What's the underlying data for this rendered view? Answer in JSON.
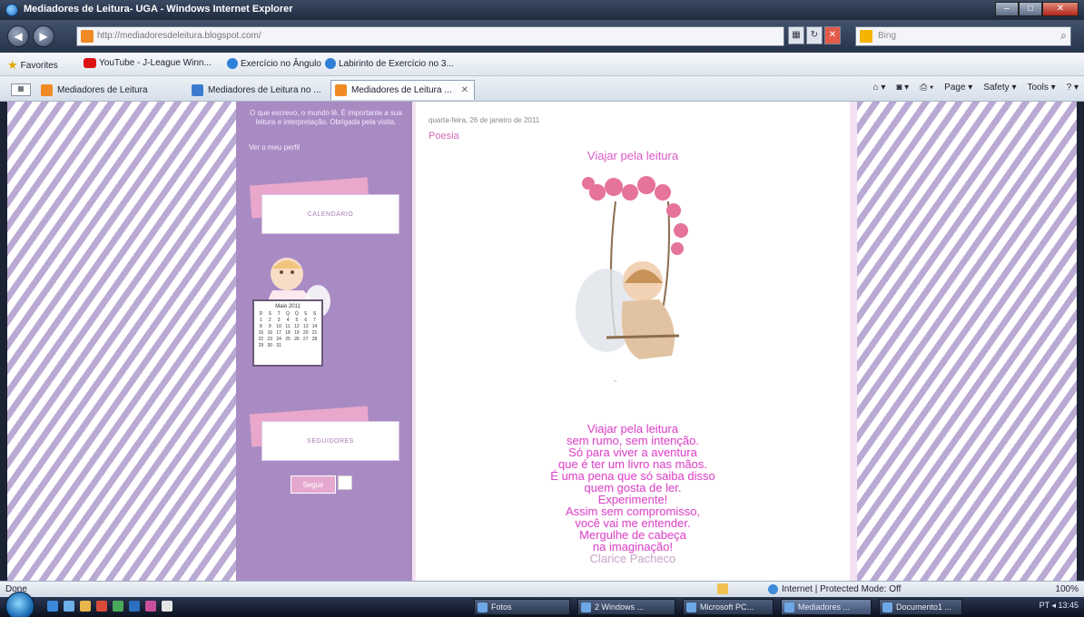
{
  "window": {
    "title": "Mediadores de Leitura- UGA - Windows Internet Explorer",
    "buttons": {
      "minimize": "–",
      "maximize": "□",
      "close": "✕"
    }
  },
  "addressbar": {
    "back_icon": "back-arrow-icon",
    "forward_icon": "forward-arrow-icon",
    "url": "http://mediadoresdeleitura.blogspot.com/",
    "search_placeholder": "Bing"
  },
  "favorites": {
    "label": "Favorites",
    "items": [
      {
        "label": "YouTube - J-League Winn..."
      },
      {
        "label": "Exercício no Ângulo"
      },
      {
        "label": "Labirinto de Exercício no 3..."
      }
    ]
  },
  "tabs": [
    {
      "label": "Mediadores de Leitura"
    },
    {
      "label": "Mediadores de Leitura no ..."
    },
    {
      "label": "Mediadores de Leitura ...",
      "active": true
    }
  ],
  "commandbar": {
    "page": "Page ▾",
    "safety": "Safety ▾",
    "tools": "Tools ▾",
    "help": "? ▾"
  },
  "sidebar": {
    "text": "O que escrevo, o mundo lê. É importante a sua leitura e interpretação. Obrigada pela visita.",
    "link": "Ver o meu perfil",
    "box1_label": "CALENDÁRIO",
    "calendar": {
      "caption": "Maio 2011",
      "days": [
        "D",
        "S",
        "T",
        "Q",
        "Q",
        "S",
        "S",
        "1",
        "2",
        "3",
        "4",
        "5",
        "6",
        "7",
        "8",
        "9",
        "10",
        "11",
        "12",
        "13",
        "14",
        "15",
        "16",
        "17",
        "18",
        "19",
        "20",
        "21",
        "22",
        "23",
        "24",
        "25",
        "26",
        "27",
        "28",
        "29",
        "30",
        "31"
      ]
    },
    "box2_label": "SEGUIDORES",
    "follow_label": "Seguir"
  },
  "post": {
    "date": "quarta-feira, 26 de janeiro de 2011",
    "title": "Poesia",
    "heading": "Viajar pela leitura",
    "poem": [
      "Viajar pela leitura",
      "sem rumo, sem intenção.",
      "Só para viver a aventura",
      "que é ter um livro nas mãos.",
      "É uma pena que só saiba disso",
      "quem gosta de ler.",
      "Experimente!",
      "Assim sem compromisso,",
      "você vai me entender.",
      "Mergulhe de cabeça",
      "na imaginação!"
    ],
    "author": "Clarice Pacheco"
  },
  "statusbar": {
    "left": "Done",
    "zone": "Internet | Protected Mode: Off",
    "zoom": "100%"
  },
  "taskbar": {
    "tasks": [
      {
        "label": "Fotos"
      },
      {
        "label": "2 Windows ..."
      },
      {
        "label": "Microsoft PC..."
      },
      {
        "label": "Mediadores ...",
        "active": true
      },
      {
        "label": "Documento1 ..."
      }
    ],
    "tray": "PT  ◂  13:45"
  }
}
